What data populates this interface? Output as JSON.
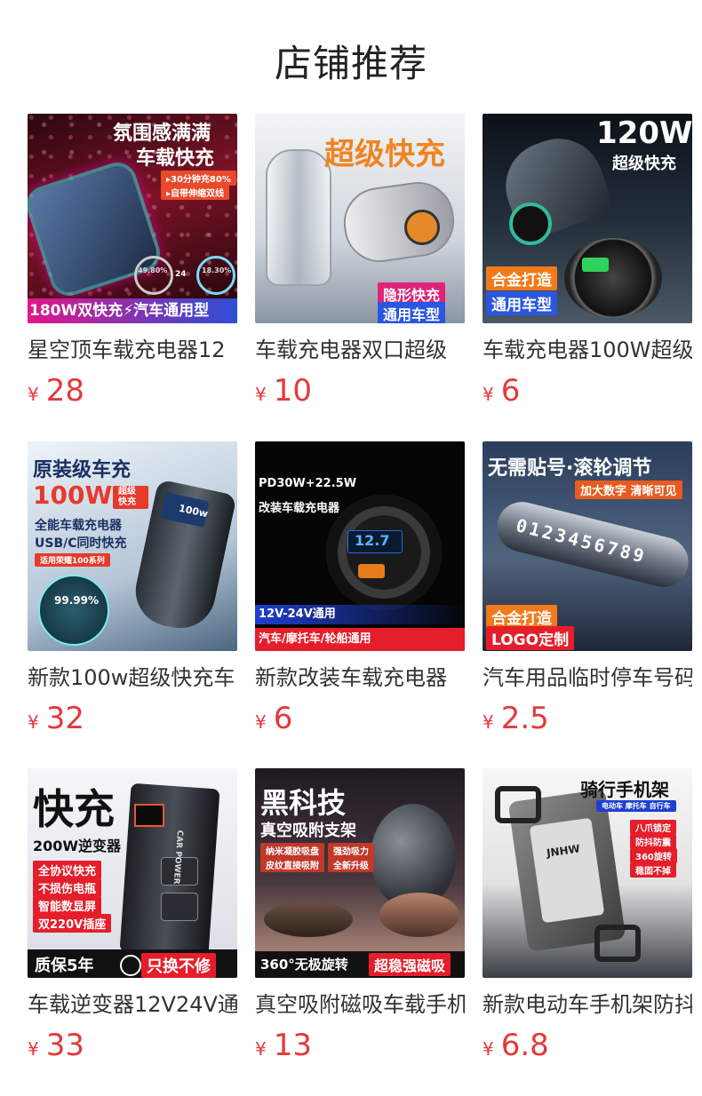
{
  "header": {
    "title": "店铺推荐"
  },
  "currency_symbol": "¥",
  "products": [
    {
      "name": "星空顶车载充电器12",
      "price": "28",
      "image": {
        "bg": "#5a0f1c",
        "headline": "氛围感满满",
        "headline2": "车载快充",
        "tag1": "▸30分钟充80%",
        "tag2": "▸自带伸缩双线",
        "bottom": "180W双快充⚡汽车通用型",
        "gauge1": "49.80%",
        "gauge2": "24",
        "gauge3": "18.30%"
      }
    },
    {
      "name": "车载充电器双口超级",
      "price": "10",
      "image": {
        "bg": "#d8dde3",
        "headline": "超级快充",
        "tag1": "隐形快充",
        "tag2": "通用车型"
      }
    },
    {
      "name": "车载充电器100W超级",
      "price": "6",
      "image": {
        "bg": "#1c2632",
        "headline": "120W",
        "headline2": "超级快充",
        "tag1": "合金打造",
        "tag2": "通用车型"
      }
    },
    {
      "name": "新款100w超级快充车",
      "price": "32",
      "image": {
        "bg": "#dfe6ee",
        "headline": "原装级车充",
        "headline2": "100W",
        "badge": "超级快充",
        "line1": "全能车载充电器",
        "line2": "USB/C同时快充",
        "tag1": "适用荣耀100系列",
        "percent": "99.99%",
        "screen": "100w"
      }
    },
    {
      "name": "新款改装车载充电器",
      "price": "6",
      "image": {
        "bg": "#0a0a0a",
        "headline": "PD30W+22.5W",
        "headline2": "改装车载充电器",
        "display": "12.7",
        "tag1": "12V-24V通用",
        "tag2": "汽车/摩托车/轮船通用"
      }
    },
    {
      "name": "汽车用品临时停车号码",
      "price": "2.5",
      "image": {
        "bg": "#3a4a63",
        "headline": "无需贴号·滚轮调节",
        "headline2": "加大数字 清晰可见",
        "digits": "0123456789",
        "tag1": "合金打造",
        "tag2": "LOGO定制"
      }
    },
    {
      "name": "车载逆变器12V24V通",
      "price": "33",
      "image": {
        "bg": "#e6e9ee",
        "headline": "快充",
        "headline2": "200W逆变器",
        "list": [
          "全协议快充",
          "不损伤电瓶",
          "智能数显屏",
          "双220V插座"
        ],
        "bottom1": "质保5年",
        "bottom2": "只换不修",
        "device": "CAR POWER"
      }
    },
    {
      "name": "真空吸附磁吸车载手机",
      "price": "13",
      "image": {
        "bg": "#2b2028",
        "headline": "黑科技",
        "headline2": "真空吸附支架",
        "tag1": "纳米凝胶吸盘",
        "tag2": "强劲吸力",
        "tag3": "皮纹直接吸附",
        "tag4": "全新升级",
        "bottom1": "360°无极旋转",
        "bottom2": "超稳强磁吸"
      }
    },
    {
      "name": "新款电动车手机架防抖",
      "price": "6.8",
      "image": {
        "bg": "#f2f2f2",
        "headline": "骑行手机架",
        "headline2": "电动车 摩托车 自行车",
        "list": [
          "八爪锁定",
          "防抖防震",
          "360旋转",
          "稳固不掉"
        ],
        "brand": "JNHW"
      }
    }
  ]
}
